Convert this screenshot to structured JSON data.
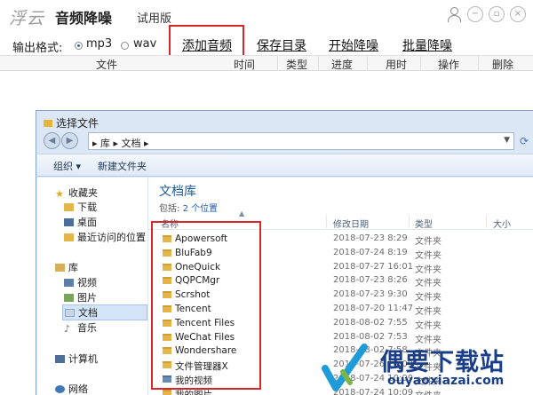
{
  "app": {
    "logo_text": "浮云",
    "name": "音频降噪",
    "edition": "试用版",
    "window_controls": [
      "user-icon",
      "minimize-icon",
      "restore-icon",
      "close-icon"
    ]
  },
  "toolbar": {
    "format_label": "输出格式:",
    "format_options": [
      "mp3",
      "wav"
    ],
    "selected_format": "mp3",
    "buttons": [
      "添加音频",
      "保存目录",
      "开始降噪",
      "批量降噪"
    ]
  },
  "grid": {
    "columns": [
      "文件",
      "时间",
      "类型",
      "进度",
      "用时",
      "操作",
      "删除"
    ]
  },
  "dialog": {
    "title": "选择文件",
    "address": "▸ 库 ▸ 文档 ▸",
    "commands": [
      "组织 ▾",
      "新建文件夹"
    ],
    "nav": {
      "favorites": "收藏夹",
      "fav_items": [
        "下载",
        "桌面",
        "最近访问的位置"
      ],
      "library": "库",
      "lib_items": [
        "视频",
        "图片",
        "文档",
        "音乐"
      ],
      "computer": "计算机",
      "network": "网络"
    },
    "library_title": "文档库",
    "library_sub": "包括:",
    "library_link": "2 个位置",
    "columns": [
      "名称",
      "修改日期",
      "类型",
      "大小"
    ],
    "files": [
      {
        "name": "Apowersoft",
        "date": "2018-07-23 8:29",
        "type": "文件夹",
        "icon": "folder"
      },
      {
        "name": "BluFab9",
        "date": "2018-07-24 8:19",
        "type": "文件夹",
        "icon": "folder"
      },
      {
        "name": "OneQuick",
        "date": "2018-07-27 16:01",
        "type": "文件夹",
        "icon": "folder"
      },
      {
        "name": "QQPCMgr",
        "date": "2018-07-23 8:26",
        "type": "文件夹",
        "icon": "folder"
      },
      {
        "name": "Scrshot",
        "date": "2018-07-23 9:30",
        "type": "文件夹",
        "icon": "folder"
      },
      {
        "name": "Tencent",
        "date": "2018-07-20 11:47",
        "type": "文件夹",
        "icon": "folder"
      },
      {
        "name": "Tencent Files",
        "date": "2018-08-02 7:55",
        "type": "文件夹",
        "icon": "folder"
      },
      {
        "name": "WeChat Files",
        "date": "2018-08-02 7:53",
        "type": "文件夹",
        "icon": "folder"
      },
      {
        "name": "Wondershare",
        "date": "2018-08-02 7:58",
        "type": "文件夹",
        "icon": "folder"
      },
      {
        "name": "文件管理器X",
        "date": "2018-07-26 10:09",
        "type": "文件夹",
        "icon": "folder"
      },
      {
        "name": "我的视频",
        "date": "2018-07-24 10:09",
        "type": "文件夹",
        "icon": "video-folder"
      },
      {
        "name": "我的图片",
        "date": "2018-07-24 10:09",
        "type": "文件夹",
        "icon": "folder"
      }
    ]
  },
  "watermark": {
    "text": "偶要下载站",
    "url": "ouyaoxiazai.com"
  },
  "colors": {
    "highlight": "#d6282b",
    "dialog_frame": "#dbe7f5",
    "library_title": "#1e5a96",
    "watermark": "#1a3f88"
  }
}
